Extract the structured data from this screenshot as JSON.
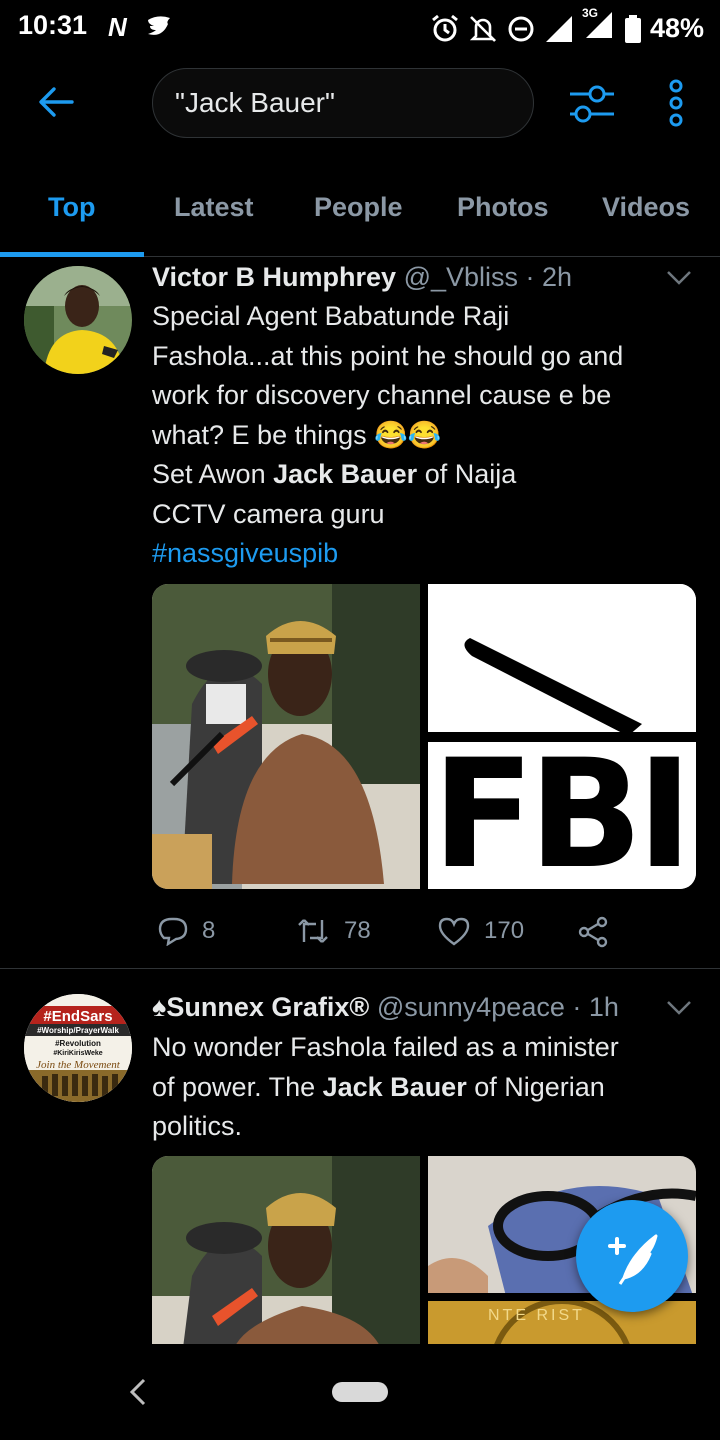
{
  "status_bar": {
    "time": "10:31",
    "app_icons": "N ❧",
    "network_label": "3G",
    "battery": "48%"
  },
  "search": {
    "query": "\"Jack Bauer\""
  },
  "tabs": [
    {
      "label": "Top",
      "active": true
    },
    {
      "label": "Latest",
      "active": false
    },
    {
      "label": "People",
      "active": false
    },
    {
      "label": "Photos",
      "active": false
    },
    {
      "label": "Videos",
      "active": false
    }
  ],
  "tweets": [
    {
      "name": "Victor B Humphrey",
      "handle": "@_Vbliss",
      "time": "· 2h",
      "lines": [
        "Special Agent Babatunde Raji",
        "Fashola...at this point he should go and",
        "work for discovery channel cause e be",
        "what? E be things 😂😂",
        "Set Awon ",
        "Jack Bauer",
        " of Naija",
        "CCTV camera guru"
      ],
      "hashtag": "#nassgiveuspib",
      "fbi_text": "FBI",
      "replies": "8",
      "retweets": "78",
      "likes": "170"
    },
    {
      "name": "♠Sunnex Grafix®",
      "handle": "@sunny4peace",
      "time": "· 1h",
      "avatar_text_1": "#EndSars",
      "avatar_text_2": "#Worship/PrayerWalk",
      "avatar_text_3": "#Revolution",
      "avatar_text_4": "#KiriKirisWeke",
      "avatar_text_5": "Join the Movement",
      "line1": "No wonder Fashola failed as a minister",
      "line2_a": "of power. The ",
      "line2_b": "Jack Bauer",
      "line2_c": " of Nigerian",
      "line3": "politics.",
      "seal_text": "NTE   RIST"
    }
  ],
  "colors": {
    "accent": "#1d9bf0",
    "text_secondary": "#8b98a5",
    "background": "#000000"
  }
}
